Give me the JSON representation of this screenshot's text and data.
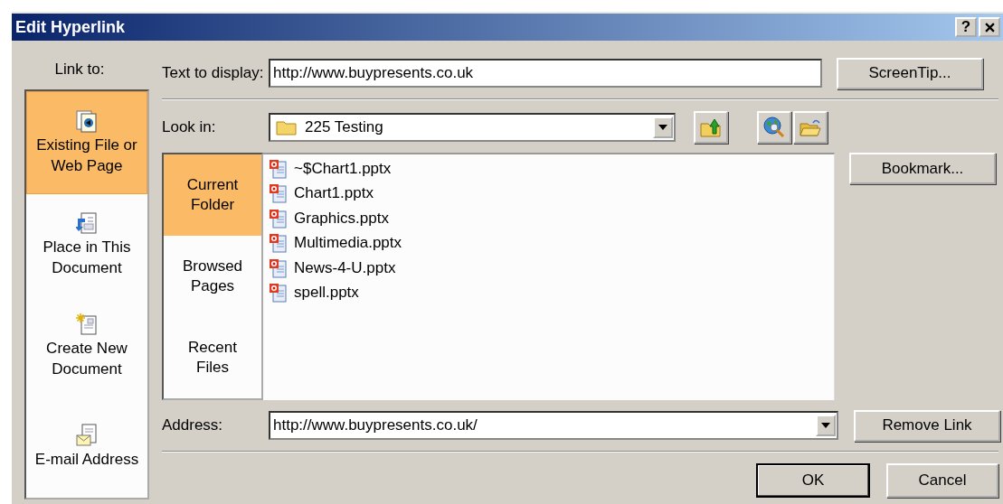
{
  "window": {
    "title": "Edit Hyperlink",
    "help_button": "?"
  },
  "link_to": {
    "label": "Link to:",
    "items": [
      {
        "kind": "file",
        "label": "Existing File or\nWeb Page",
        "selected": true
      },
      {
        "kind": "place",
        "label": "Place in This\nDocument",
        "selected": false
      },
      {
        "kind": "new",
        "label": "Create New\nDocument",
        "selected": false
      },
      {
        "kind": "email",
        "label": "E-mail Address",
        "selected": false
      }
    ]
  },
  "text_to_display": {
    "label": "Text to display:",
    "value": "http://www.buypresents.co.uk"
  },
  "screentip_button": "ScreenTip...",
  "look_in": {
    "label": "Look in:",
    "value": "225 Testing"
  },
  "places": [
    {
      "label": "Current\nFolder",
      "selected": true
    },
    {
      "label": "Browsed\nPages",
      "selected": false
    },
    {
      "label": "Recent\nFiles",
      "selected": false
    }
  ],
  "files": [
    {
      "name": "~$Chart1.pptx"
    },
    {
      "name": "Chart1.pptx"
    },
    {
      "name": "Graphics.pptx"
    },
    {
      "name": "Multimedia.pptx"
    },
    {
      "name": "News-4-U.pptx"
    },
    {
      "name": "spell.pptx"
    }
  ],
  "bookmark_button": "Bookmark...",
  "address": {
    "label": "Address:",
    "value": "http://www.buypresents.co.uk/"
  },
  "remove_link_button": "Remove Link",
  "dialog_buttons": [
    {
      "label": "OK",
      "default": true
    },
    {
      "label": "Cancel",
      "default": false
    }
  ]
}
